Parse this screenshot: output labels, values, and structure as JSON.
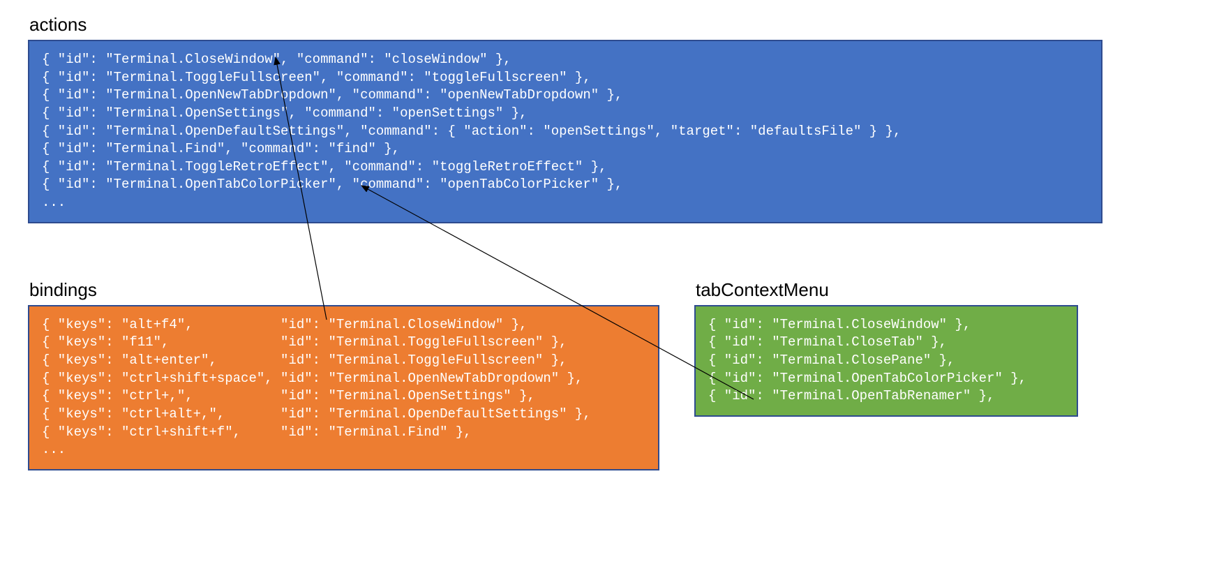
{
  "sections": {
    "actions": {
      "title": "actions",
      "lines": [
        "{ \"id\": \"Terminal.CloseWindow\", \"command\": \"closeWindow\" },",
        "{ \"id\": \"Terminal.ToggleFullscreen\", \"command\": \"toggleFullscreen\" },",
        "{ \"id\": \"Terminal.OpenNewTabDropdown\", \"command\": \"openNewTabDropdown\" },",
        "{ \"id\": \"Terminal.OpenSettings\", \"command\": \"openSettings\" },",
        "{ \"id\": \"Terminal.OpenDefaultSettings\", \"command\": { \"action\": \"openSettings\", \"target\": \"defaultsFile\" } },",
        "{ \"id\": \"Terminal.Find\", \"command\": \"find\" },",
        "{ \"id\": \"Terminal.ToggleRetroEffect\", \"command\": \"toggleRetroEffect\" },",
        "{ \"id\": \"Terminal.OpenTabColorPicker\", \"command\": \"openTabColorPicker\" },",
        "..."
      ]
    },
    "bindings": {
      "title": "bindings",
      "lines": [
        "{ \"keys\": \"alt+f4\",           \"id\": \"Terminal.CloseWindow\" },",
        "{ \"keys\": \"f11\",              \"id\": \"Terminal.ToggleFullscreen\" },",
        "{ \"keys\": \"alt+enter\",        \"id\": \"Terminal.ToggleFullscreen\" },",
        "{ \"keys\": \"ctrl+shift+space\", \"id\": \"Terminal.OpenNewTabDropdown\" },",
        "{ \"keys\": \"ctrl+,\",           \"id\": \"Terminal.OpenSettings\" },",
        "{ \"keys\": \"ctrl+alt+,\",       \"id\": \"Terminal.OpenDefaultSettings\" },",
        "{ \"keys\": \"ctrl+shift+f\",     \"id\": \"Terminal.Find\" },",
        "..."
      ]
    },
    "tabContextMenu": {
      "title": "tabContextMenu",
      "lines": [
        "{ \"id\": \"Terminal.CloseWindow\" },",
        "{ \"id\": \"Terminal.CloseTab\" },",
        "{ \"id\": \"Terminal.ClosePane\" },",
        "{ \"id\": \"Terminal.OpenTabColorPicker\" },",
        "{ \"id\": \"Terminal.OpenTabRenamer\" },"
      ]
    }
  },
  "colors": {
    "actions_bg": "#4472c4",
    "bindings_bg": "#ed7d31",
    "context_bg": "#70ad47",
    "border": "#2e4b8f"
  },
  "arrows": [
    {
      "from": "bindings.Terminal.CloseWindow",
      "to": "actions.Terminal.CloseWindow"
    },
    {
      "from": "tabContextMenu.Terminal.OpenTabColorPicker",
      "to": "actions.Terminal.OpenTabColorPicker"
    }
  ]
}
